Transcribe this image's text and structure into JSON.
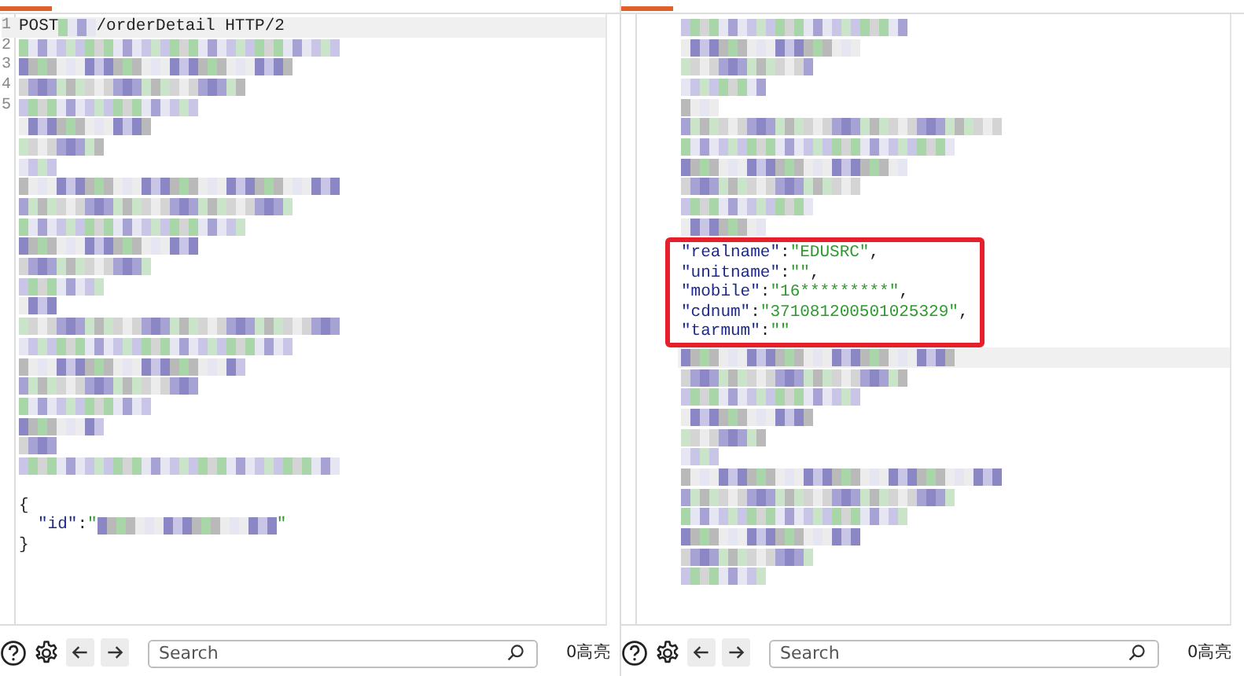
{
  "request": {
    "rows": [
      {
        "number": "1",
        "current": true,
        "parts": [
          {
            "kind": "plain",
            "text": "POST"
          },
          {
            "kind": "redacted"
          },
          {
            "kind": "plain",
            "text": "/orderDetail HTTP/2"
          }
        ]
      },
      {
        "number": "2",
        "current": false,
        "parts": [
          {
            "kind": "redacted"
          }
        ]
      },
      {
        "number": "3",
        "current": false,
        "parts": [
          {
            "kind": "redacted"
          }
        ]
      },
      {
        "number": "4",
        "current": false,
        "parts": [
          {
            "kind": "redacted"
          }
        ]
      },
      {
        "number": "5",
        "current": false,
        "parts": [
          {
            "kind": "redacted"
          }
        ]
      },
      {
        "current": false,
        "parts": [
          {
            "kind": "redacted"
          }
        ]
      },
      {
        "current": false,
        "parts": [
          {
            "kind": "redacted"
          }
        ]
      },
      {
        "current": false,
        "parts": [
          {
            "kind": "redacted"
          }
        ]
      },
      {
        "current": false,
        "parts": [
          {
            "kind": "redacted"
          }
        ]
      },
      {
        "current": false,
        "parts": [
          {
            "kind": "redacted"
          }
        ]
      },
      {
        "current": false,
        "parts": [
          {
            "kind": "redacted"
          }
        ]
      },
      {
        "current": false,
        "parts": [
          {
            "kind": "redacted"
          }
        ]
      },
      {
        "current": false,
        "parts": [
          {
            "kind": "redacted"
          }
        ]
      },
      {
        "current": false,
        "parts": [
          {
            "kind": "redacted"
          }
        ]
      },
      {
        "current": false,
        "parts": [
          {
            "kind": "redacted"
          }
        ]
      },
      {
        "current": false,
        "parts": [
          {
            "kind": "redacted"
          }
        ]
      },
      {
        "current": false,
        "parts": [
          {
            "kind": "redacted"
          }
        ]
      },
      {
        "current": false,
        "parts": [
          {
            "kind": "redacted"
          }
        ]
      },
      {
        "current": false,
        "parts": [
          {
            "kind": "redacted"
          }
        ]
      },
      {
        "current": false,
        "parts": [
          {
            "kind": "redacted"
          }
        ]
      },
      {
        "current": false,
        "parts": [
          {
            "kind": "redacted"
          }
        ]
      },
      {
        "current": false,
        "parts": [
          {
            "kind": "redacted"
          }
        ]
      },
      {
        "current": false,
        "parts": [
          {
            "kind": "redacted"
          }
        ]
      },
      {
        "current": false,
        "parts": []
      },
      {
        "current": false,
        "parts": [
          {
            "kind": "punct",
            "text": "{"
          }
        ]
      },
      {
        "current": false,
        "parts": [
          {
            "kind": "indent"
          },
          {
            "kind": "key",
            "text": "\"id\""
          },
          {
            "kind": "punct",
            "text": ":"
          },
          {
            "kind": "value",
            "text": "\""
          },
          {
            "kind": "redacted"
          },
          {
            "kind": "value",
            "text": "\""
          }
        ]
      },
      {
        "current": false,
        "parts": [
          {
            "kind": "punct",
            "text": "}"
          }
        ]
      }
    ]
  },
  "response": {
    "rows_before": [
      {
        "current": false,
        "parts": [
          {
            "kind": "redacted"
          }
        ]
      },
      {
        "current": false,
        "parts": [
          {
            "kind": "redacted"
          }
        ]
      },
      {
        "current": false,
        "parts": [
          {
            "kind": "redacted"
          }
        ]
      },
      {
        "current": false,
        "parts": [
          {
            "kind": "redacted"
          }
        ]
      },
      {
        "current": false,
        "parts": [
          {
            "kind": "redacted"
          }
        ]
      },
      {
        "current": false,
        "parts": [
          {
            "kind": "redacted"
          }
        ]
      },
      {
        "current": false,
        "parts": [
          {
            "kind": "redacted"
          }
        ]
      },
      {
        "current": false,
        "parts": [
          {
            "kind": "redacted"
          }
        ]
      },
      {
        "current": false,
        "parts": [
          {
            "kind": "redacted"
          }
        ]
      },
      {
        "current": false,
        "parts": [
          {
            "kind": "redacted"
          }
        ]
      },
      {
        "current": false,
        "parts": [
          {
            "kind": "redacted"
          }
        ]
      }
    ],
    "highlight": {
      "rows": [
        {
          "current": false,
          "parts": [
            {
              "kind": "key",
              "text": "\"realname\""
            },
            {
              "kind": "punct",
              "text": ":"
            },
            {
              "kind": "value",
              "text": "\"EDUSRC\""
            },
            {
              "kind": "punct",
              "text": ","
            }
          ]
        },
        {
          "current": false,
          "parts": [
            {
              "kind": "key",
              "text": "\"unitname\""
            },
            {
              "kind": "punct",
              "text": ":"
            },
            {
              "kind": "value",
              "text": "\"\""
            },
            {
              "kind": "punct",
              "text": ","
            }
          ]
        },
        {
          "current": false,
          "parts": [
            {
              "kind": "key",
              "text": "\"mobile\""
            },
            {
              "kind": "punct",
              "text": ":"
            },
            {
              "kind": "value",
              "text": "\"16*********\""
            },
            {
              "kind": "punct",
              "text": ","
            }
          ]
        },
        {
          "current": false,
          "parts": [
            {
              "kind": "key",
              "text": "\"cdnum\""
            },
            {
              "kind": "punct",
              "text": ":"
            },
            {
              "kind": "value",
              "text": "\"371081200501025329\""
            },
            {
              "kind": "punct",
              "text": ","
            }
          ]
        },
        {
          "current": false,
          "parts": [
            {
              "kind": "key",
              "text": "\"tarmum\""
            },
            {
              "kind": "punct",
              "text": ":"
            },
            {
              "kind": "value",
              "text": "\"\""
            }
          ]
        }
      ]
    },
    "rows_after": [
      {
        "current": true,
        "parts": [
          {
            "kind": "redacted"
          }
        ]
      },
      {
        "current": false,
        "parts": [
          {
            "kind": "redacted"
          }
        ]
      },
      {
        "current": false,
        "parts": [
          {
            "kind": "redacted"
          }
        ]
      },
      {
        "current": false,
        "parts": [
          {
            "kind": "redacted"
          }
        ]
      },
      {
        "current": false,
        "parts": [
          {
            "kind": "redacted"
          }
        ]
      },
      {
        "current": false,
        "parts": [
          {
            "kind": "redacted"
          }
        ]
      },
      {
        "current": false,
        "parts": [
          {
            "kind": "redacted"
          }
        ]
      },
      {
        "current": false,
        "parts": [
          {
            "kind": "redacted"
          }
        ]
      },
      {
        "current": false,
        "parts": [
          {
            "kind": "redacted"
          }
        ]
      },
      {
        "current": false,
        "parts": [
          {
            "kind": "redacted"
          }
        ]
      },
      {
        "current": false,
        "parts": [
          {
            "kind": "redacted"
          }
        ]
      },
      {
        "current": false,
        "parts": [
          {
            "kind": "redacted"
          }
        ]
      }
    ]
  },
  "toolbars": [
    {
      "search": {
        "placeholder": "Search"
      },
      "highlights": "0高亮"
    },
    {
      "search": {
        "placeholder": "Search"
      },
      "highlights": "0高亮"
    }
  ]
}
